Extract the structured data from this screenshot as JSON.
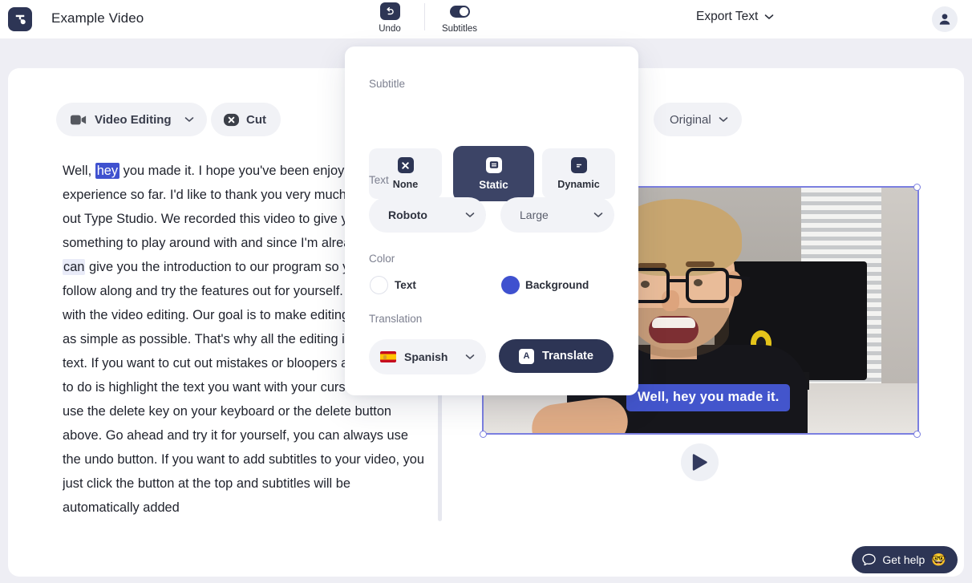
{
  "topbar": {
    "logo_icon": "type-studio-logo-icon",
    "project_title": "Example Video",
    "undo": {
      "label": "Undo",
      "icon": "undo-icon"
    },
    "subtitles": {
      "label": "Subtitles",
      "icon": "toggle-switch-on-icon",
      "state": "on"
    },
    "export": {
      "label": "Export Text",
      "icon": "chevron-down-icon"
    },
    "avatar_icon": "user-avatar-icon"
  },
  "toolbar": {
    "video_editing": {
      "label": "Video Editing",
      "icon": "video-camera-icon",
      "chevron": "chevron-down-icon"
    },
    "cut": {
      "label": "Cut",
      "icon": "x-circle-icon"
    },
    "original": {
      "label": "Original",
      "chevron": "chevron-down-icon"
    }
  },
  "transcript": {
    "before_selection": "Well, ",
    "selection": "hey",
    "after_selection_1": " you made it. I hope you've been enjoying your experience so far. I'd like to thank you very much for checking out Type Studio. We recorded this video to give you guys something to play around with and since I'm already here I ",
    "soft_selection": "can",
    "after_selection_2": " give you the introduction to our program so you can follow along and try the features out for yourself. Let's start with the video editing. Our goal is to make editing your video as simple as possible. That's why all the editing is done in the text. If you want to cut out mistakes or bloopers all you have to do is highlight the text you want with your cursor and either use the delete key on your keyboard or the delete button above. Go ahead and try it for yourself, you can always use the undo button. If you want to add subtitles to your video, you just click the button at the top and subtitles will be automatically added"
  },
  "video": {
    "subtitle_overlay_text": "Well, hey you made it.",
    "play_icon": "play-icon",
    "selection_handles": [
      "handle-top-left",
      "handle-top-right",
      "handle-bottom-left",
      "handle-bottom-right"
    ]
  },
  "modal": {
    "subtitle": {
      "section_label": "Subtitle",
      "options": [
        {
          "label": "None",
          "icon": "x-square-icon",
          "active": false
        },
        {
          "label": "Static",
          "icon": "static-caption-icon",
          "active": true
        },
        {
          "label": "Dynamic",
          "icon": "dynamic-caption-icon",
          "active": false
        }
      ]
    },
    "text": {
      "section_label": "Text",
      "font": {
        "value": "Roboto",
        "chevron": "chevron-down-icon"
      },
      "size": {
        "value": "Large",
        "chevron": "chevron-down-icon"
      }
    },
    "color": {
      "section_label": "Color",
      "text": {
        "label": "Text",
        "swatch": "#ffffff"
      },
      "background": {
        "label": "Background",
        "swatch": "#3f51cf"
      }
    },
    "translation": {
      "section_label": "Translation",
      "language": {
        "value": "Spanish",
        "flag": "spain-flag-icon",
        "chevron": "chevron-down-icon"
      },
      "button": {
        "label": "Translate",
        "icon": "translate-icon"
      }
    }
  },
  "help": {
    "label": "Get help",
    "icon": "chat-bubble-icon",
    "emoji": "🤓"
  },
  "colors": {
    "page_bg": "#eeeef4",
    "card_bg": "#ffffff",
    "accent_dark": "#2d3555",
    "accent_blue": "#3f51cf",
    "pill_bg": "#f2f3f7"
  }
}
